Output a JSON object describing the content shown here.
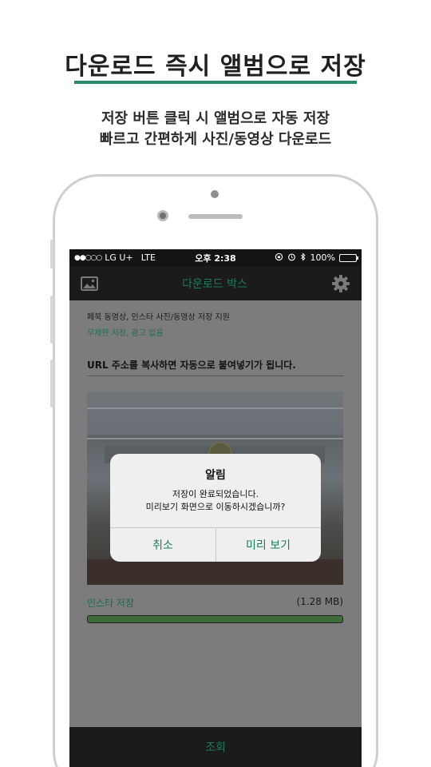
{
  "promo": {
    "headline": "다운로드 즉시 앨범으로 저장",
    "sub_line1": "저장 버튼 클릭 시 앨범으로 자동 저장",
    "sub_line2": "빠르고 간편하게 사진/동영상 다운로드"
  },
  "statusbar": {
    "signal_dots": "●●○○○",
    "carrier": "LG U+",
    "network": "LTE",
    "time": "오후 2:38",
    "icons": [
      "orientation-lock-icon",
      "alarm-icon",
      "bluetooth-icon"
    ],
    "battery": "100%",
    "battery_level": 1.0
  },
  "appbar": {
    "title": "다운로드 박스",
    "left_icon": "gallery-icon",
    "right_icon": "gear-icon"
  },
  "content": {
    "info_line1": "페북 동영상, 인스타 사진/동영상 저장 지원",
    "info_line2": "무제한 저장, 광고 없음",
    "url_hint": "URL 주소를 복사하면 자동으로 붙여넣기가 됩니다.",
    "save_label": "인스타 저장",
    "file_size": "(1.28 MB)",
    "progress": 1.0
  },
  "bottombar": {
    "label": "조회"
  },
  "dialog": {
    "title": "알림",
    "message_line1": "저장이 완료되었습니다.",
    "message_line2": "미리보기 화면으로 이동하시겠습니까?",
    "cancel_label": "취소",
    "confirm_label": "미리 보기"
  },
  "colors": {
    "accent": "#1a7c5f",
    "underline": "#2a8a6e",
    "dim_background": "#7c7c7c",
    "bar_background": "#1b1b1b"
  }
}
